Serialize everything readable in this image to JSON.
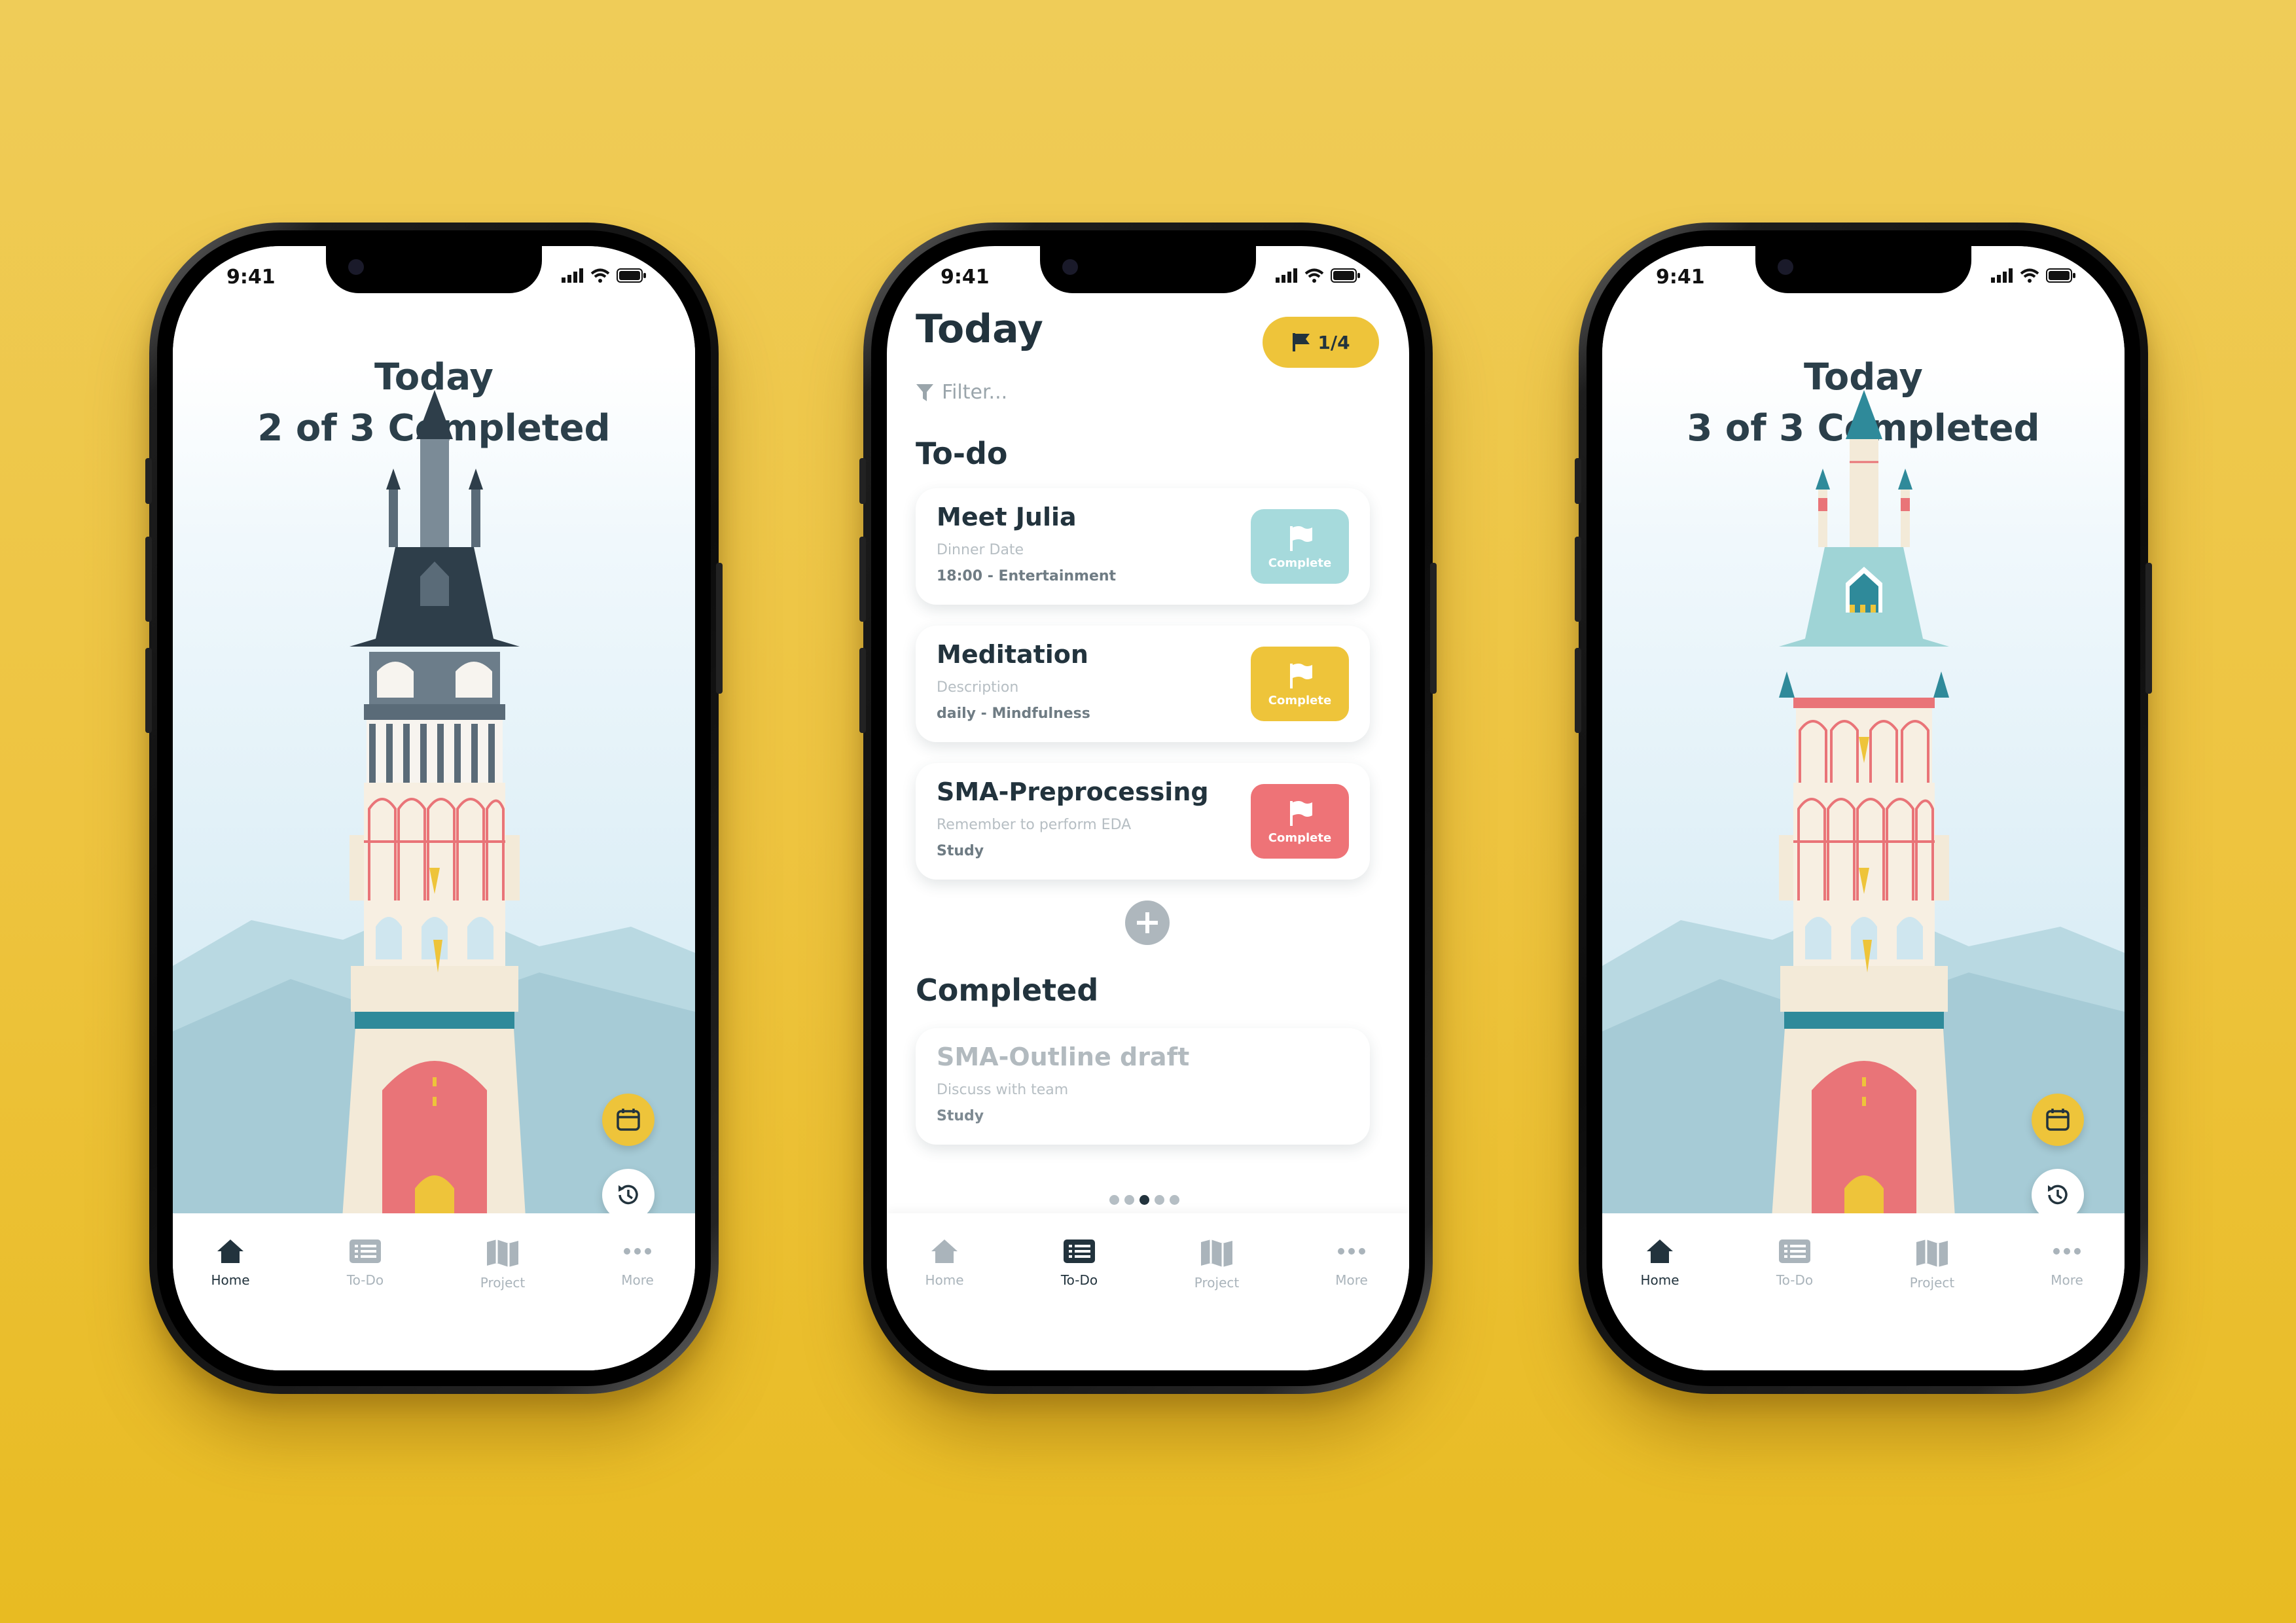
{
  "status": {
    "time": "9:41"
  },
  "left_phone": {
    "title_line1": "Today",
    "title_line2": "2 of 3 Completed",
    "fab_calendar_icon": "calendar-icon",
    "fab_history_icon": "history-icon"
  },
  "right_phone": {
    "title_line1": "Today",
    "title_line2": "3 of 3 Completed",
    "fab_calendar_icon": "calendar-icon",
    "fab_history_icon": "history-icon"
  },
  "todo_phone": {
    "title": "Today",
    "badge": "1/4",
    "filter_placeholder": "Filter...",
    "todo_heading": "To-do",
    "completed_heading": "Completed",
    "tasks": [
      {
        "title": "Meet Julia",
        "desc": "Dinner Date",
        "meta": "18:00 - Entertainment",
        "button": "Complete",
        "color": "#a6dadc"
      },
      {
        "title": "Meditation",
        "desc": "Description",
        "meta": "daily - Mindfulness",
        "button": "Complete",
        "color": "#eec43a"
      },
      {
        "title": "SMA-Preprocessing",
        "desc": "Remember to perform EDA",
        "meta": "Study",
        "button": "Complete",
        "color": "#ee7377"
      }
    ],
    "completed_tasks": [
      {
        "title": "SMA-Outline draft",
        "desc": "Discuss with team",
        "meta": "Study"
      }
    ],
    "page_dots": {
      "count": 5,
      "active_index": 2
    }
  },
  "tabs": [
    {
      "label": "Home",
      "icon": "home-icon"
    },
    {
      "label": "To-Do",
      "icon": "list-icon"
    },
    {
      "label": "Project",
      "icon": "map-icon"
    },
    {
      "label": "More",
      "icon": "more-icon"
    }
  ],
  "colors": {
    "background": "#eec440",
    "accent_yellow": "#eec43a",
    "text_dark": "#22333d",
    "teal": "#a6dadc",
    "red": "#ee7377"
  }
}
